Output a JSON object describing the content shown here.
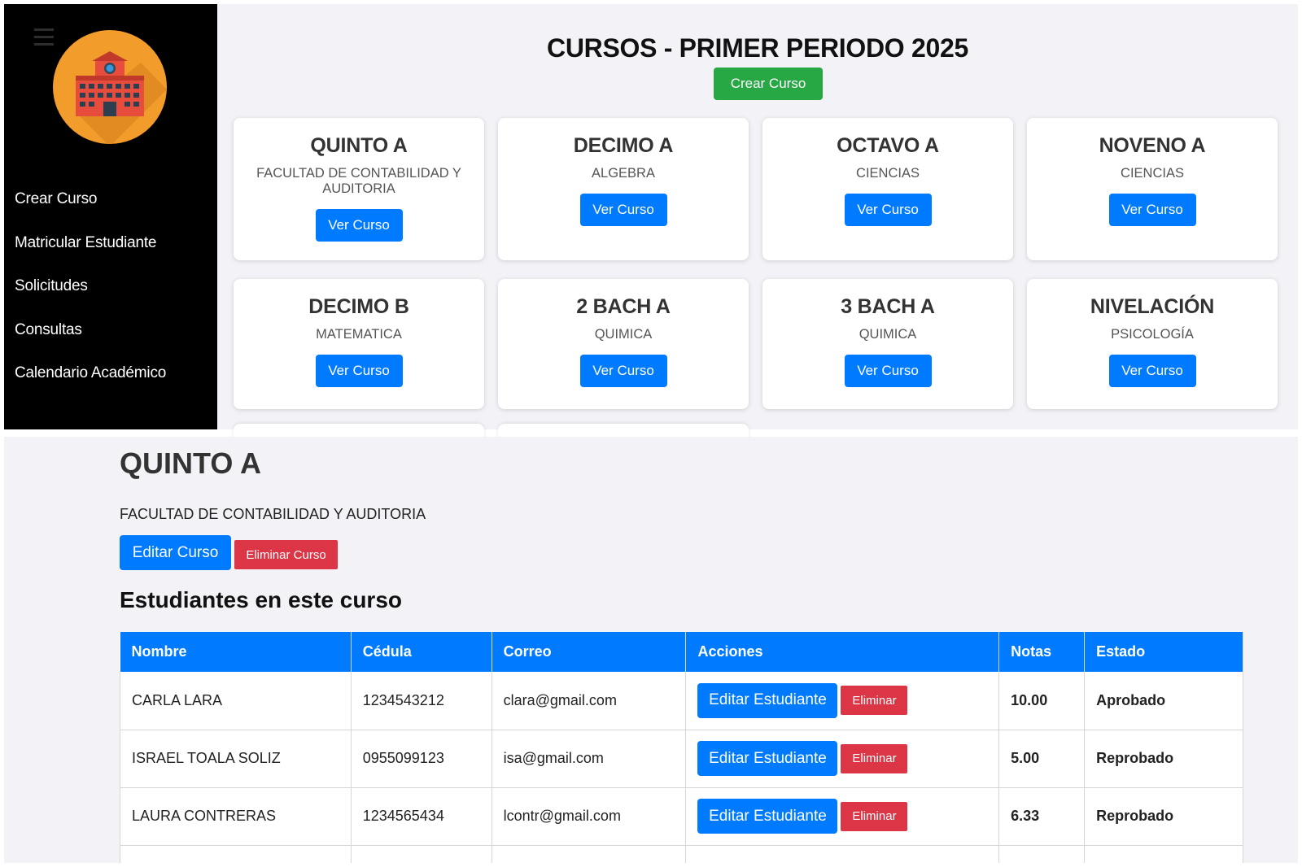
{
  "sidebar": {
    "nav": [
      "Crear Curso",
      "Matricular Estudiante",
      "Solicitudes",
      "Consultas",
      "Calendario Académico"
    ]
  },
  "courses": {
    "title": "CURSOS - PRIMER PERIODO 2025",
    "create_label": "Crear Curso",
    "view_label": "Ver Curso",
    "cards": [
      {
        "name": "QUINTO A",
        "subject": "FACULTAD DE CONTABILIDAD Y AUDITORIA"
      },
      {
        "name": "DECIMO A",
        "subject": "ALGEBRA"
      },
      {
        "name": "OCTAVO A",
        "subject": "CIENCIAS"
      },
      {
        "name": "NOVENO A",
        "subject": "CIENCIAS"
      },
      {
        "name": "DECIMO B",
        "subject": "MATEMATICA"
      },
      {
        "name": "2 BACH A",
        "subject": "QUIMICA"
      },
      {
        "name": "3 BACH A",
        "subject": "QUIMICA"
      },
      {
        "name": "NIVELACIÓN",
        "subject": "PSICOLOGÍA"
      }
    ]
  },
  "detail": {
    "title": "QUINTO A",
    "subtitle": "FACULTAD DE CONTABILIDAD Y AUDITORIA",
    "edit_label": "Editar Curso",
    "delete_label": "Eliminar Curso",
    "students_title": "Estudiantes en este curso",
    "columns": [
      "Nombre",
      "Cédula",
      "Correo",
      "Acciones",
      "Notas",
      "Estado"
    ],
    "edit_student_label": "Editar Estudiante",
    "delete_student_label": "Eliminar",
    "rows": [
      {
        "name": "CARLA LARA",
        "id": "1234543212",
        "email": "clara@gmail.com",
        "grade": "10.00",
        "status": "Aprobado"
      },
      {
        "name": "ISRAEL TOALA SOLIZ",
        "id": "0955099123",
        "email": "isa@gmail.com",
        "grade": "5.00",
        "status": "Reprobado"
      },
      {
        "name": "LAURA CONTRERAS",
        "id": "1234565434",
        "email": "lcontr@gmail.com",
        "grade": "6.33",
        "status": "Reprobado"
      }
    ]
  },
  "colors": {
    "primary": "#007bff",
    "success": "#28a745",
    "danger": "#dc3545",
    "sidebar": "#000000",
    "logo_circle": "#f29c2b",
    "building": "#e84c3d"
  }
}
